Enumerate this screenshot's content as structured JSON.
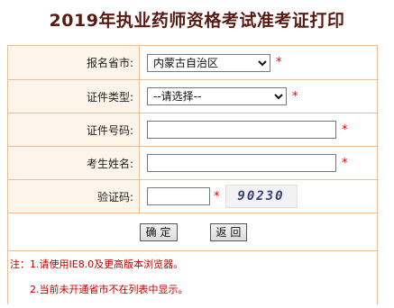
{
  "title": "2019年执业药师资格考试准考证打印",
  "form": {
    "province": {
      "label": "报名省市:",
      "selected": "内蒙古自治区",
      "required": "*"
    },
    "id_type": {
      "label": "证件类型:",
      "selected": "--请选择--",
      "required": "*"
    },
    "id_number": {
      "label": "证件号码:",
      "value": "",
      "required": "*"
    },
    "name": {
      "label": "考生姓名:",
      "value": "",
      "required": "*"
    },
    "captcha": {
      "label": "验证码:",
      "value": "",
      "required": "*",
      "image_text": "90230"
    }
  },
  "buttons": {
    "confirm": "确 定",
    "back": "返 回"
  },
  "notes": {
    "prefix": "注：",
    "line1": "1.请使用IE8.0及更高版本浏览器。",
    "line2": "2.当前未开通省市不在列表中显示。"
  },
  "colors": {
    "title": "#5a1a12",
    "border": "#e8bf9a",
    "label_bg": "#fdf5ea",
    "required": "#e00000",
    "note": "#c00000"
  }
}
